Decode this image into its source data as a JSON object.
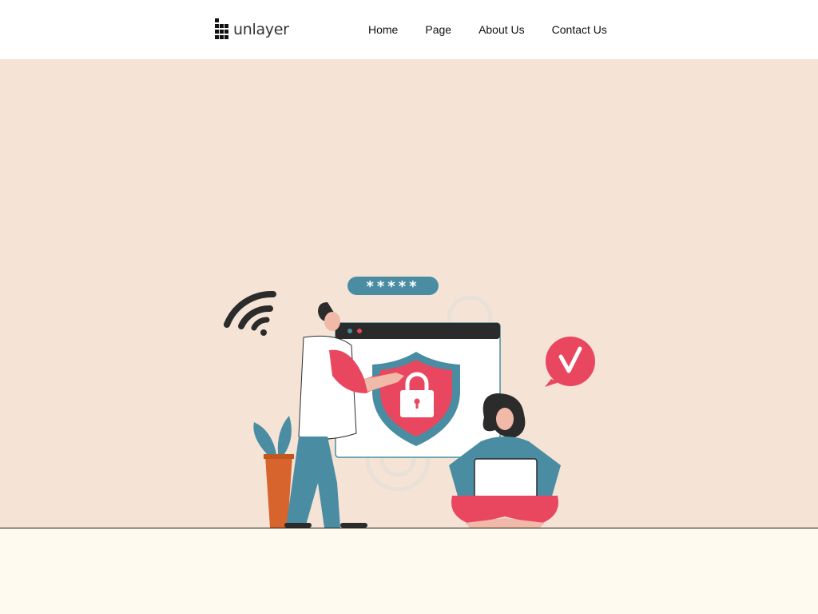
{
  "header": {
    "logo": {
      "text": "unlayer",
      "icon": "unlayer-logo-icon"
    },
    "nav": [
      {
        "label": "Home"
      },
      {
        "label": "Page"
      },
      {
        "label": "About Us"
      },
      {
        "label": "Contact Us"
      }
    ]
  },
  "hero": {
    "illustration": {
      "password_mask": "*****",
      "icons": [
        "wifi-icon",
        "browser-window",
        "shield-lock-icon",
        "checkmark-bubble-icon",
        "gear-icon",
        "plant-pot",
        "man-figure",
        "woman-with-laptop-figure"
      ]
    }
  },
  "colors": {
    "header_bg": "#ffffff",
    "hero_bg": "#f5e3d6",
    "footer_bg": "#fffaf0",
    "accent_red": "#e8475f",
    "accent_teal": "#4a8da3",
    "dark": "#2b2b2b"
  }
}
